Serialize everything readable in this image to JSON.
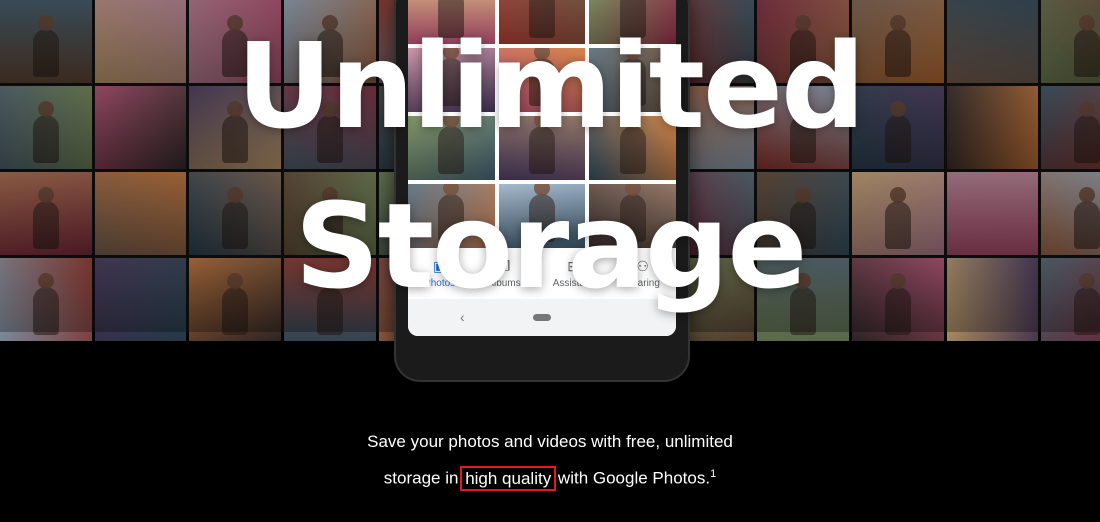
{
  "hero": {
    "headline": "Unlimited Storage"
  },
  "phone": {
    "nav": [
      {
        "label": "Photos",
        "icon": "photo-icon",
        "active": true
      },
      {
        "label": "Albums",
        "icon": "albums-icon",
        "active": false
      },
      {
        "label": "Assistant",
        "icon": "assistant-icon",
        "active": false
      },
      {
        "label": "Sharing",
        "icon": "sharing-icon",
        "active": false
      }
    ],
    "system_back": "‹"
  },
  "tagline": {
    "line1": "Save your photos and videos with free, unlimited",
    "line2_prefix": "storage in ",
    "highlight": "high quality",
    "line2_suffix": " with Google Photos.",
    "footnote": "1"
  },
  "colors": {
    "background": "#000000",
    "highlight_box": "#e01b1b",
    "nav_active": "#1a73e8"
  }
}
